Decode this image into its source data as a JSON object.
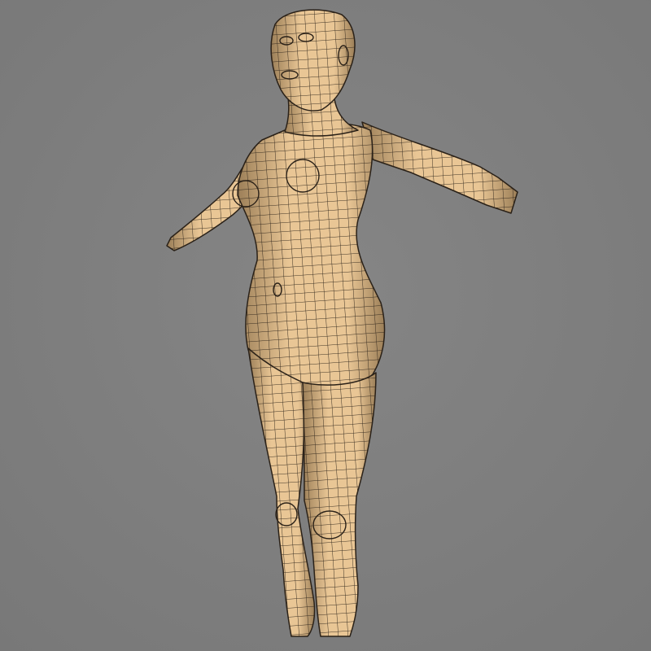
{
  "viewport": {
    "background": "#808080",
    "background_center": "#858585",
    "background_edge": "#787878"
  },
  "model": {
    "skin_color": "#e9c695",
    "skin_shadow": "#9c7f58",
    "wire_color": "#2a2118"
  }
}
